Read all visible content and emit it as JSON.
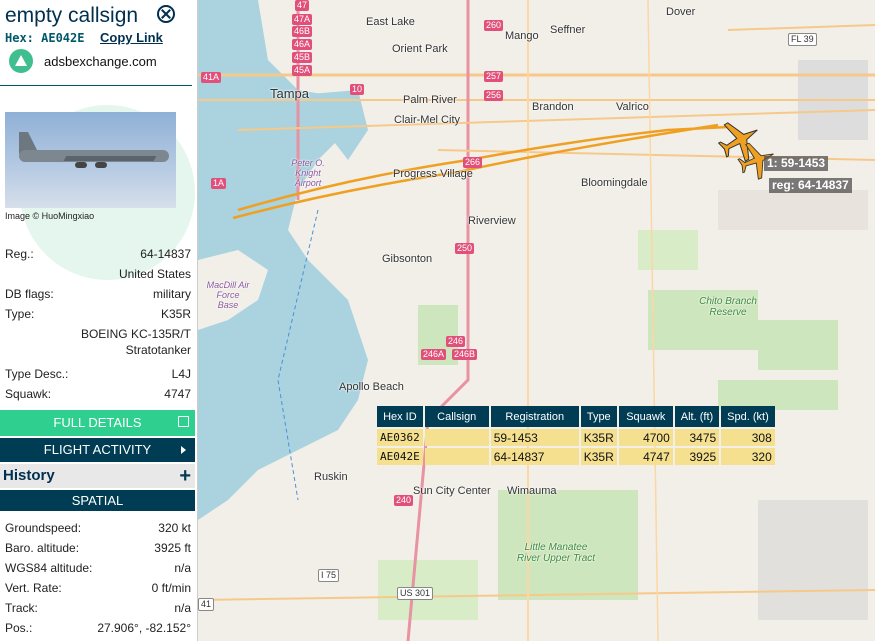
{
  "sidebar": {
    "title": "empty callsign",
    "hex_label": "Hex: AE042E",
    "copy_link": "Copy Link",
    "site": "adsbexchange.com",
    "image_caption": "Image © HuoMingxiao",
    "details": [
      {
        "label": "Reg.:",
        "value": "64-14837"
      },
      {
        "label": "",
        "value": "United States"
      },
      {
        "label": "DB flags:",
        "value": "military"
      },
      {
        "label": "Type:",
        "value": "K35R"
      },
      {
        "label": "",
        "value": "BOEING KC-135R/T"
      },
      {
        "label": "",
        "value": "Stratotanker"
      },
      {
        "label": "Type Desc.:",
        "value": "L4J"
      },
      {
        "label": "Squawk:",
        "value": "4747"
      }
    ],
    "full_details_button": "FULL DETAILS",
    "flight_activity_button": "FLIGHT ACTIVITY",
    "history_label": "History",
    "spatial_label": "SPATIAL",
    "spatial": [
      {
        "label": "Groundspeed:",
        "value": "320 kt"
      },
      {
        "label": "Baro. altitude:",
        "value": "3925 ft"
      },
      {
        "label": "WGS84 altitude:",
        "value": "n/a"
      },
      {
        "label": "Vert. Rate:",
        "value": "0 ft/min"
      },
      {
        "label": "Track:",
        "value": "n/a"
      },
      {
        "label": "Pos.:",
        "value": "27.906°, -82.152°"
      }
    ]
  },
  "map": {
    "places": [
      "East Lake",
      "Mango",
      "Seffner",
      "Dover",
      "Orient Park",
      "Tampa",
      "Palm River",
      "Clair-Mel City",
      "Brandon",
      "Valrico",
      "Progress Village",
      "Bloomingdale",
      "Riverview",
      "Gibsonton",
      "Apollo Beach",
      "Ruskin",
      "Sun City Center",
      "Wimauma"
    ],
    "parks": [
      "Chito Branch Reserve",
      "Little Manatee River Upper Tract"
    ],
    "airports": [
      "Peter O. Knight Airport",
      "MacDill Air Force Base"
    ],
    "route_shields": [
      "47",
      "47A",
      "46B",
      "46A",
      "45B",
      "45A",
      "41A",
      "260",
      "257",
      "256",
      "10",
      "FL 39",
      "266",
      "250",
      "246",
      "246A",
      "246B",
      "240",
      "I 75",
      "US 301",
      "1A",
      "41"
    ],
    "aircraft_labels": [
      "1: 59-1453",
      "reg: 64-14837"
    ]
  },
  "table": {
    "headers": [
      "Hex ID",
      "Callsign",
      "Registration",
      "Type",
      "Squawk",
      "Alt. (ft)",
      "Spd. (kt)"
    ],
    "rows": [
      [
        "AE0362",
        "",
        "59-1453",
        "K35R",
        "4700",
        "3475",
        "308"
      ],
      [
        "AE042E",
        "",
        "64-14837",
        "K35R",
        "4747",
        "3925",
        "320"
      ]
    ]
  },
  "colors": {
    "accent_dark": "#003d54",
    "accent_green": "#2fcf8f",
    "track": "#f0a020",
    "row_bg": "#f4e08f"
  }
}
